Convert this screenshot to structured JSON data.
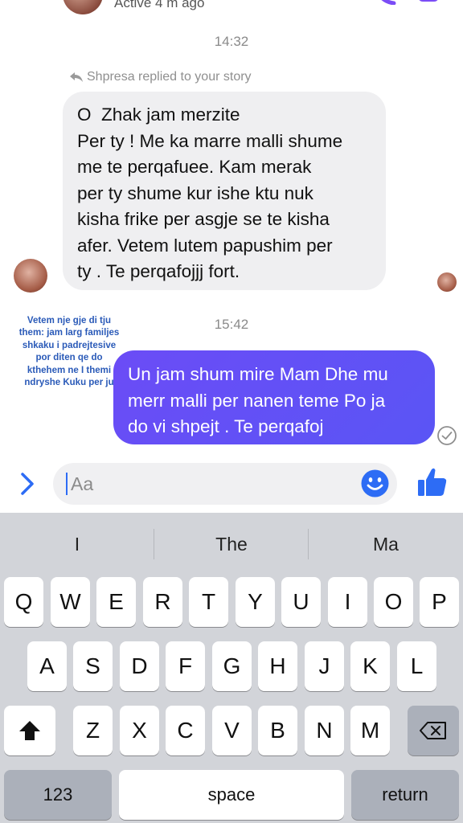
{
  "header": {
    "status": "Active 4 m ago"
  },
  "conversation": {
    "time1": "14:32",
    "reply_note": "Shpresa replied to your story",
    "incoming_lines": [
      "O  Zhak jam merzite",
      "Per ty ! Me ka marre malli shume",
      "me te perqafuee. Kam merak",
      "per ty shume kur ishe ktu nuk",
      "kisha frike per asgje se te kisha",
      "afer. Vetem lutem papushim per",
      "ty . Te perqafojjj fort."
    ],
    "time2": "15:42",
    "story_overlay_lines": [
      "Vetem nje gje di tju",
      "them: jam larg familjes",
      "shkaku i padrejtesive",
      "por diten qe do",
      "kthehem ne I themi",
      "ndryshe Kuku per ju"
    ],
    "outgoing_lines": [
      "Un jam shum mire Mam Dhe mu",
      "merr malli per nanen teme Po ja",
      "do vi shpejt . Te perqafoj"
    ]
  },
  "composer": {
    "placeholder": "Aa",
    "icons": [
      "chevron-right-icon",
      "emoji-icon",
      "thumbs-up-icon"
    ]
  },
  "keyboard": {
    "suggestions": [
      "I",
      "The",
      "Ma"
    ],
    "row1": [
      "Q",
      "W",
      "E",
      "R",
      "T",
      "Y",
      "U",
      "I",
      "O",
      "P"
    ],
    "row2": [
      "A",
      "S",
      "D",
      "F",
      "G",
      "H",
      "J",
      "K",
      "L"
    ],
    "row3": [
      "Z",
      "X",
      "C",
      "V",
      "B",
      "N",
      "M"
    ],
    "numbers_label": "123",
    "space_label": "space",
    "return_label": "return"
  },
  "colors": {
    "accent": "#2d6cf5",
    "outgoing_bubble": "#6150f6",
    "incoming_bubble": "#efeff1",
    "keyboard_bg": "#d2d4d9"
  }
}
